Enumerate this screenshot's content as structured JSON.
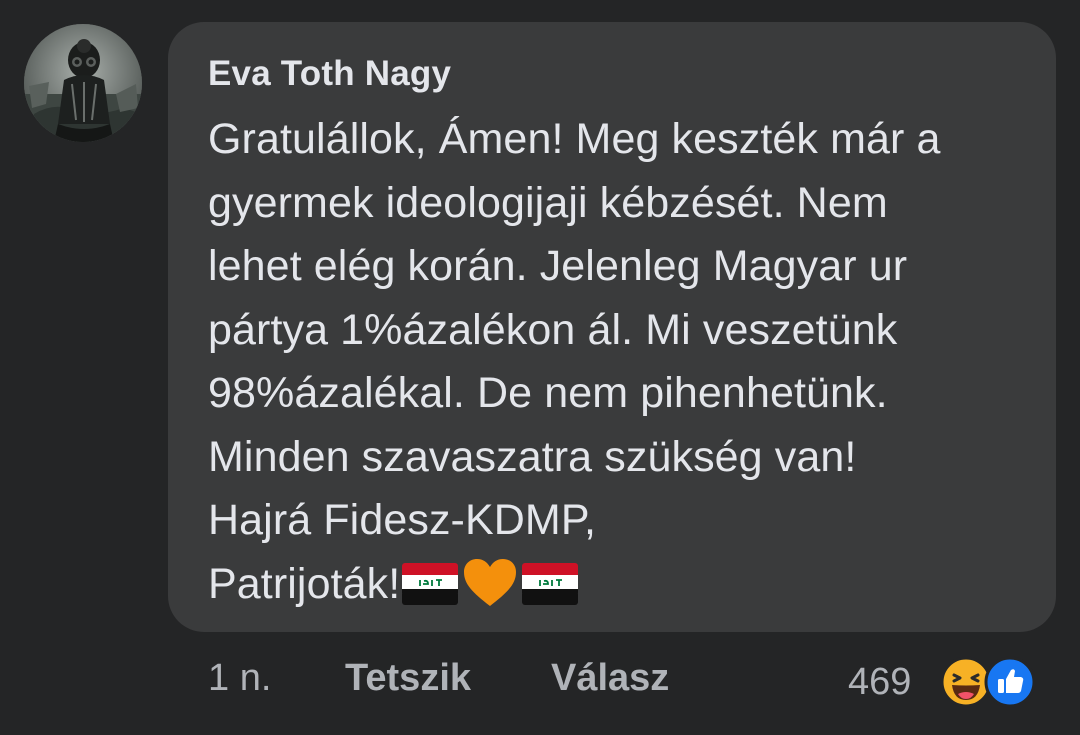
{
  "comment": {
    "author": "Eva Toth Nagy",
    "lines": [
      "Gratulállok, Ámen! Meg keszték már a",
      "gyermek ideologijaji kébzését. Nem",
      "lehet elég korán. Jelenleg Magyar ur",
      "pártya 1%ázalékon ál. Mi veszetünk",
      "98%ázalékal. De nem pihenhetünk.",
      "Minden szavaszatra szükség van!",
      "Hajrá Fidesz-KDMP,",
      "Patrijoták!"
    ],
    "trailing_emojis": [
      "iraq-flag-emoji",
      "orange-heart-emoji",
      "iraq-flag-emoji"
    ]
  },
  "actions": {
    "time": "1 n.",
    "like_label": "Tetszik",
    "reply_label": "Válasz"
  },
  "reactions": {
    "count": "469",
    "icons": [
      "haha-reaction-icon",
      "like-reaction-icon"
    ],
    "like_color": "#1877f2",
    "haha_color": "#f7b125"
  },
  "colors": {
    "background": "#242526",
    "bubble": "#3a3b3c",
    "primary_text": "#e4e6eb",
    "secondary_text": "#b0b3b8"
  }
}
